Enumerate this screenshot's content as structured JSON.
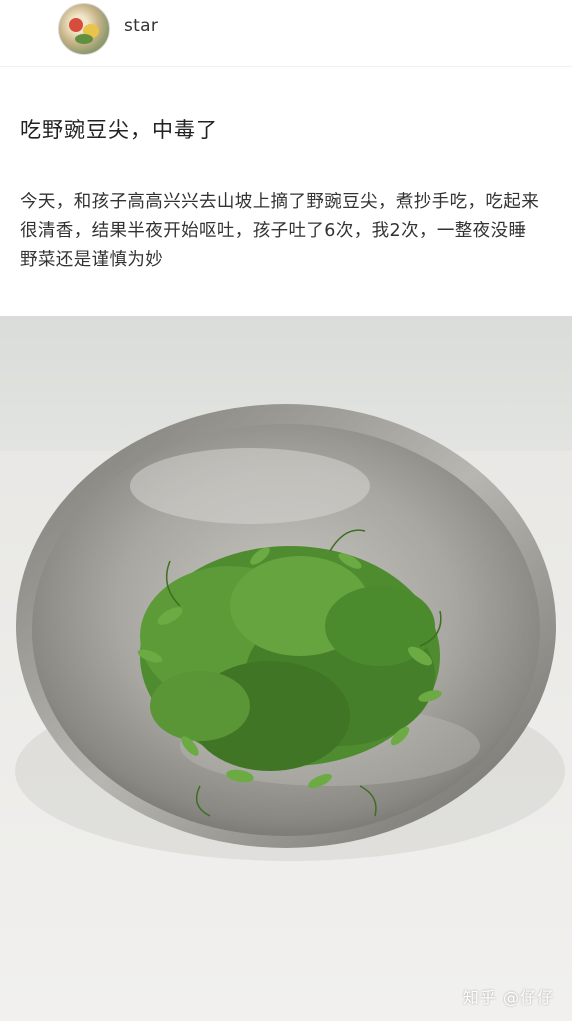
{
  "header": {
    "username": "star",
    "avatar": "user-avatar-food-photo"
  },
  "post": {
    "title": "吃野豌豆尖，中毒了",
    "paragraphs": [
      "今天，和孩子高高兴兴去山坡上摘了野豌豆尖，煮抄手吃，吃起来很清香，结果半夜开始呕吐，孩子吐了6次，我2次，一整夜没睡",
      "野菜还是谨慎为妙"
    ]
  },
  "photo": {
    "subject": "steel-bowl-of-wild-pea-shoots"
  },
  "watermark": "知乎 @仔仔",
  "colors": {
    "background": "#ffffff",
    "text": "#333333",
    "wall": "#dfe1dd",
    "table": "#ecebe8",
    "bowl_steel": "#9c9a94",
    "greens": "#4f8c2f"
  }
}
